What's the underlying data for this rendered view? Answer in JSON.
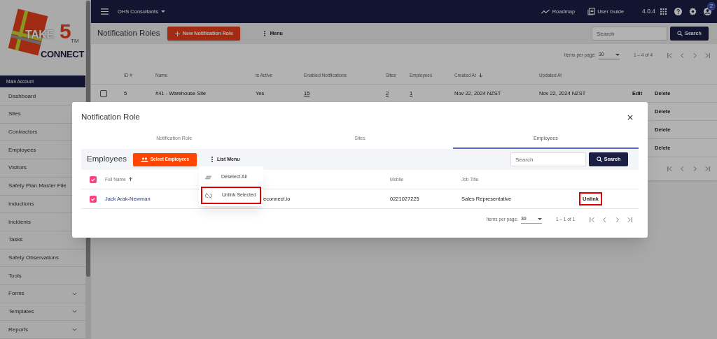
{
  "sidebar": {
    "logo": {
      "word_1": "TAKE",
      "numeral": "5",
      "word_2": "CONNECT",
      "trademark": "TM"
    },
    "section": "Main Account",
    "items": [
      {
        "label": "Dashboard",
        "expandable": false
      },
      {
        "label": "Sites",
        "expandable": false
      },
      {
        "label": "Contractors",
        "expandable": false
      },
      {
        "label": "Employees",
        "expandable": false
      },
      {
        "label": "Visitors",
        "expandable": false
      },
      {
        "label": "Safety Plan Master File",
        "expandable": false
      },
      {
        "label": "Inductions",
        "expandable": false
      },
      {
        "label": "Incidents",
        "expandable": false
      },
      {
        "label": "Tasks",
        "expandable": false
      },
      {
        "label": "Safety Observations",
        "expandable": false
      },
      {
        "label": "Tools",
        "expandable": false
      },
      {
        "label": "Forms",
        "expandable": true
      },
      {
        "label": "Templates",
        "expandable": true
      },
      {
        "label": "Reports",
        "expandable": true
      }
    ]
  },
  "topbar": {
    "account": "OHS Consultants",
    "links": [
      {
        "label": "Roadmap",
        "kind": "trend"
      },
      {
        "label": "User Guide",
        "kind": "book"
      }
    ],
    "version": "4.0.4",
    "notification_count": "2"
  },
  "page": {
    "title": "Notification Roles",
    "new_button": "New Notification Role",
    "menu": "Menu",
    "search": {
      "placeholder": "Search"
    },
    "search_button": "Search",
    "pagination": {
      "label": "Items per page:",
      "page_size": "30",
      "range": "1 – 4 of 4"
    },
    "table": {
      "columns": [
        {
          "label": "ID #",
          "sorted": false
        },
        {
          "label": "Name",
          "sorted": false
        },
        {
          "label": "Is Active",
          "sorted": false
        },
        {
          "label": "Enabled Notifications",
          "sorted": false
        },
        {
          "label": "Sites",
          "sorted": false
        },
        {
          "label": "Employees",
          "sorted": false
        },
        {
          "label": "Created At",
          "sorted": true,
          "descending": true
        },
        {
          "label": "Updated At",
          "sorted": false
        }
      ],
      "rows": [
        {
          "checked": false,
          "id": "5",
          "name": "#41 - Warehouse Site",
          "active": "Yes",
          "notifications": "15",
          "sites": "2",
          "employees": "1",
          "created": "Nov 22, 2024 NZST",
          "updated": "Nov 22, 2024 NZST",
          "edit": "Edit",
          "delete": "Delete"
        },
        {
          "delete": "Delete"
        },
        {
          "delete": "Delete"
        },
        {
          "delete": "Delete"
        }
      ]
    }
  },
  "dialog": {
    "title": "Notification Role",
    "tabs": [
      {
        "label": "Notification Role",
        "selected": false
      },
      {
        "label": "Sites",
        "selected": false
      },
      {
        "label": "Employees",
        "selected": true
      }
    ],
    "section": "Employees",
    "select_button": "Select Employees",
    "list_menu": "List Menu",
    "search": {
      "placeholder": "Search"
    },
    "search_button": "Search",
    "menu_items": [
      {
        "label": "Deselect All",
        "kind": "deselect",
        "highlighted": false
      },
      {
        "label": "Unlink Selected",
        "kind": "unlink",
        "highlighted": true
      }
    ],
    "table": {
      "all_checked": true,
      "columns": [
        {
          "label": "Full Name",
          "sorted": true,
          "descending": false
        },
        {
          "label": "Mobile",
          "sorted": false
        },
        {
          "label": "Job Title",
          "sorted": false
        }
      ],
      "rows": [
        {
          "checked": true,
          "name": "Jack Arak-Newman",
          "email": "econnect.io",
          "mobile": "0221027225",
          "job_title": "Sales Representative",
          "action": "Unlink",
          "action_highlighted": true
        }
      ]
    },
    "pagination": {
      "label": "Items per page:",
      "page_size": "30",
      "range": "1 – 1 of 1"
    }
  }
}
